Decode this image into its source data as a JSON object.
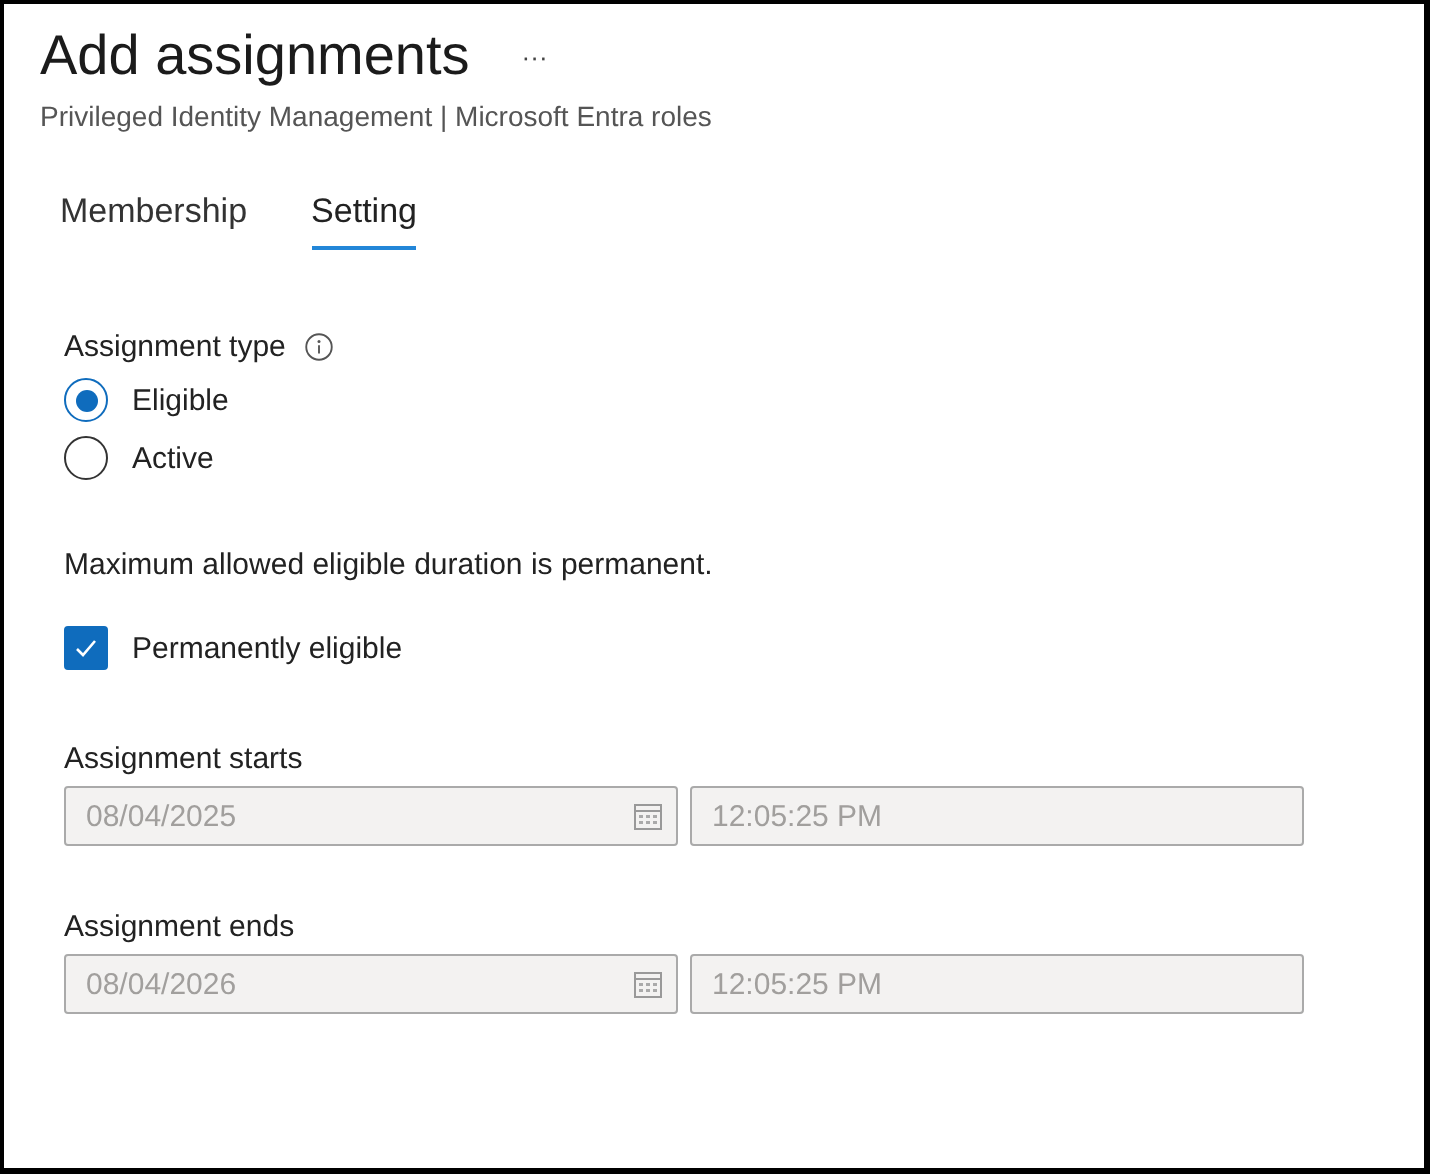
{
  "header": {
    "title": "Add assignments",
    "more": "···",
    "subtitle": "Privileged Identity Management | Microsoft Entra roles"
  },
  "tabs": [
    {
      "label": "Membership",
      "selected": false
    },
    {
      "label": "Setting",
      "selected": true
    }
  ],
  "assignment_type": {
    "label": "Assignment type",
    "options": [
      {
        "label": "Eligible",
        "selected": true
      },
      {
        "label": "Active",
        "selected": false
      }
    ]
  },
  "note": "Maximum allowed eligible duration is permanent.",
  "permanent": {
    "label": "Permanently eligible",
    "checked": true
  },
  "dates": [
    {
      "label": "Assignment starts",
      "date": "08/04/2025",
      "time": "12:05:25 PM",
      "disabled": true
    },
    {
      "label": "Assignment ends",
      "date": "08/04/2026",
      "time": "12:05:25 PM",
      "disabled": true
    }
  ]
}
